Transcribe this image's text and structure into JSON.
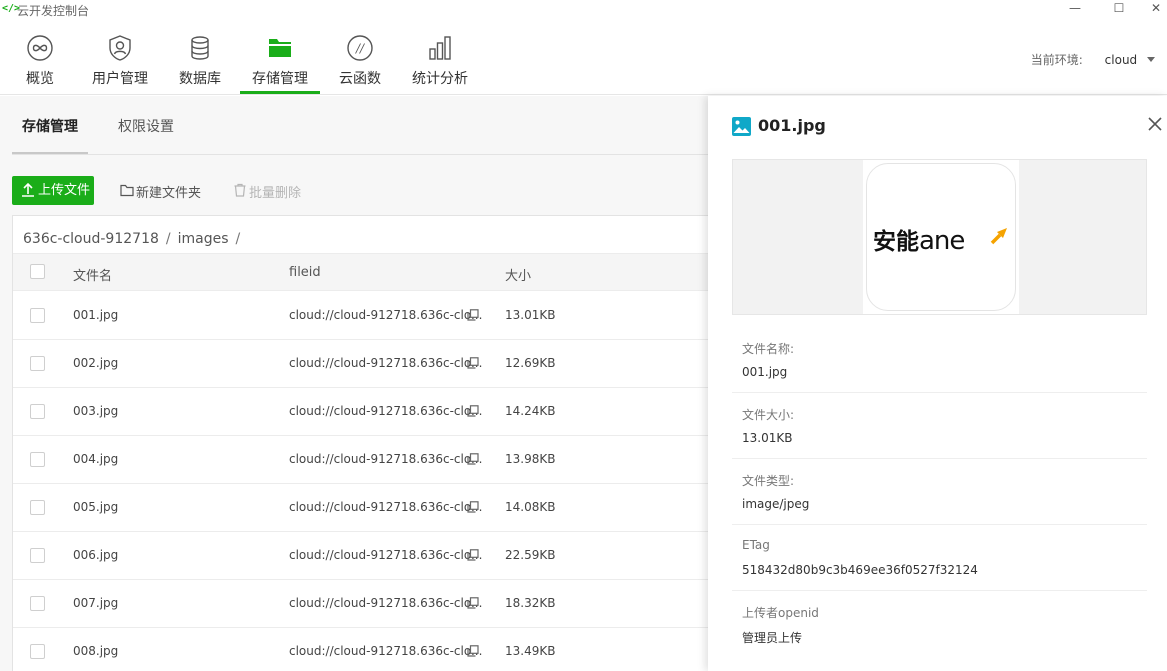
{
  "app": {
    "logo_glyph": "</>",
    "title": "云开发控制台"
  },
  "window": {
    "minimize": "—",
    "maximize": "☐",
    "close": "✕"
  },
  "topnav": {
    "items": [
      {
        "label": "概览",
        "icon": "infinity-circle-icon",
        "active": false
      },
      {
        "label": "用户管理",
        "icon": "user-shield-icon",
        "active": false
      },
      {
        "label": "数据库",
        "icon": "database-icon",
        "active": false
      },
      {
        "label": "存储管理",
        "icon": "folder-icon",
        "active": true
      },
      {
        "label": "云函数",
        "icon": "function-icon",
        "active": false
      },
      {
        "label": "统计分析",
        "icon": "bar-chart-icon",
        "active": false
      }
    ],
    "env_label": "当前环境:",
    "env_value": "cloud"
  },
  "subtabs": [
    {
      "label": "存储管理",
      "active": true
    },
    {
      "label": "权限设置",
      "active": false
    }
  ],
  "toolbar": {
    "upload": "上传文件",
    "new_folder": "新建文件夹",
    "batch_delete": "批量删除"
  },
  "breadcrumb": {
    "bucket": "636c-cloud-912718",
    "folder": "images",
    "sep": "/"
  },
  "table": {
    "headers": {
      "name": "文件名",
      "fileid": "fileid",
      "size": "大小"
    },
    "rows": [
      {
        "name": "001.jpg",
        "fileid": "cloud://cloud-912718.636c-clo...",
        "size": "13.01KB"
      },
      {
        "name": "002.jpg",
        "fileid": "cloud://cloud-912718.636c-clo...",
        "size": "12.69KB"
      },
      {
        "name": "003.jpg",
        "fileid": "cloud://cloud-912718.636c-clo...",
        "size": "14.24KB"
      },
      {
        "name": "004.jpg",
        "fileid": "cloud://cloud-912718.636c-clo...",
        "size": "13.98KB"
      },
      {
        "name": "005.jpg",
        "fileid": "cloud://cloud-912718.636c-clo...",
        "size": "14.08KB"
      },
      {
        "name": "006.jpg",
        "fileid": "cloud://cloud-912718.636c-clo...",
        "size": "22.59KB"
      },
      {
        "name": "007.jpg",
        "fileid": "cloud://cloud-912718.636c-clo...",
        "size": "18.32KB"
      },
      {
        "name": "008.jpg",
        "fileid": "cloud://cloud-912718.636c-clo...",
        "size": "13.49KB"
      }
    ]
  },
  "detail": {
    "title": "001.jpg",
    "preview_logo": {
      "cn": "安能",
      "en": "ane"
    },
    "fields": [
      {
        "label": "文件名称:",
        "value": "001.jpg"
      },
      {
        "label": "文件大小:",
        "value": "13.01KB"
      },
      {
        "label": "文件类型:",
        "value": "image/jpeg"
      },
      {
        "label": "ETag",
        "value": "518432d80b9c3b469ee36f0527f32124"
      },
      {
        "label": "上传者openid",
        "value": "管理员上传"
      }
    ]
  },
  "colors": {
    "accent": "#1aad19",
    "logo_arrow": "#f5a300"
  }
}
